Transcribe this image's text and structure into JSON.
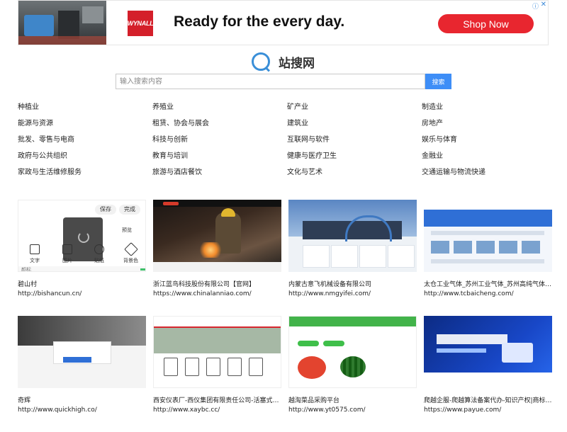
{
  "ad": {
    "logo_text": "WYNALL",
    "headline": "Ready for the every day.",
    "cta": "Shop Now",
    "info_icon": "info-icon",
    "close_icon": "close-icon"
  },
  "site": {
    "title": "站搜网",
    "logo_icon": "search-ring-icon"
  },
  "search": {
    "placeholder": "输入搜索内容",
    "value": "",
    "button": "搜索"
  },
  "categories": [
    "种植业",
    "养殖业",
    "矿产业",
    "制造业",
    "能源与资源",
    "租赁、协会与展会",
    "建筑业",
    "房地产",
    "批发、零售与电商",
    "科技与创新",
    "互联网与软件",
    "娱乐与体育",
    "政府与公共组织",
    "教育与培训",
    "健康与医疗卫生",
    "金融业",
    "家政与生活维修服务",
    "旅游与酒店餐饮",
    "文化与艺术",
    "交通运输与物流快递"
  ],
  "thumb1": {
    "save": "保存",
    "done": "完成",
    "preview": "预览",
    "labels": [
      "文字",
      "图片",
      "贴纸",
      "背景色"
    ],
    "footer": "颜标"
  },
  "sites": [
    {
      "name": "碧山村",
      "url": "http://bishancun.cn/"
    },
    {
      "name": "浙江蓝鸟科技股份有限公司【官网】",
      "url": "https://www.chinalanniao.com/"
    },
    {
      "name": "内蒙古意飞机械设备有限公司",
      "url": "http://www.nmgyifei.com/"
    },
    {
      "name": "太仓工业气体_苏州工业气体_苏州高纯气体-太仓市百程气体有限公司",
      "url": "http://www.tcbaicheng.com/"
    },
    {
      "name": "奇辉",
      "url": "http://www.quickhigh.co/"
    },
    {
      "name": "西安仪表厂-西仪集团有限责任公司-活塞式压力计",
      "url": "http://www.xaybc.cc/"
    },
    {
      "name": "越淘菜品采购平台",
      "url": "http://www.yt0575.com/"
    },
    {
      "name": "爬越企服-爬越算法备案代办-知识产权|商标注册",
      "url": "https://www.payue.com/"
    }
  ]
}
